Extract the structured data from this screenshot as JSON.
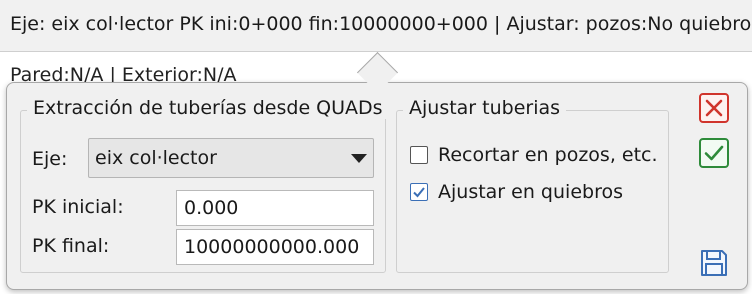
{
  "topbar": {
    "text": "Eje: eix col·lector PK ini:0+000 fin:10000000+000 | Ajustar: pozos:No quiebros:Si"
  },
  "subline": {
    "text": "Pared:N/A | Exterior:N/A"
  },
  "extraction": {
    "title": "Extracción de tuberías desde QUADs",
    "axis_label": "Eje:",
    "axis_value": "eix col·lector",
    "pk_start_label": "PK inicial:",
    "pk_start_value": "0.000",
    "pk_end_label": "PK final:",
    "pk_end_value": "10000000000.000"
  },
  "adjust": {
    "title": "Ajustar tuberias",
    "trim_label": "Recortar en pozos, etc.",
    "trim_checked": false,
    "fit_label": "Ajustar en quiebros",
    "fit_checked": true
  },
  "colors": {
    "close": "#d0342c",
    "accept": "#2e8b3a",
    "save": "#3b6fb6"
  },
  "icons": [
    "close-icon",
    "check-icon",
    "save-icon",
    "chevron-down-icon"
  ]
}
